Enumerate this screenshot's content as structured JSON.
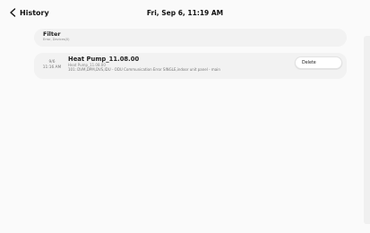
{
  "header": {
    "back_label": "History",
    "datetime": "Fri, Sep 6, 11:19 AM"
  },
  "filter": {
    "title": "Filter",
    "subtitle": "Error, Devices(0)"
  },
  "entries": [
    {
      "date": "9/6",
      "time": "11:16 AM",
      "title": "Heat Pump_11.08.00",
      "subtitle": "Heat Pump_11.08.00",
      "detail": "101: DVM,DPM,DVS,IDU - ODU Communication Error SINGLE,indoor unit panel - main",
      "action_label": "Delete"
    }
  ]
}
